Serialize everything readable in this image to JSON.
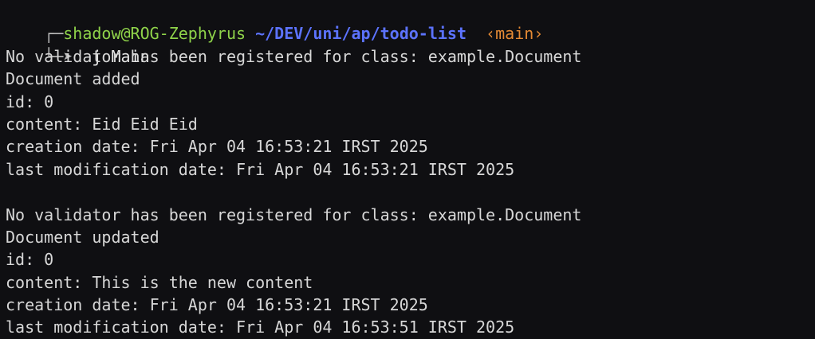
{
  "prompt": {
    "corner_top": "┌─",
    "userhost": "shadow@ROG-Zephyrus",
    "path": "~/DEV/uni/ap/todo-list",
    "branch": "‹main›",
    "corner_bottom": "└─➤",
    "command": "j Main"
  },
  "output": {
    "block1": {
      "line1": "No validator has been registered for class: example.Document",
      "line2": "Document added",
      "line3": "id: 0",
      "line4": "content: Eid Eid Eid",
      "line5": "creation date: Fri Apr 04 16:53:21 IRST 2025",
      "line6": "last modification date: Fri Apr 04 16:53:21 IRST 2025"
    },
    "block2": {
      "line1": "No validator has been registered for class: example.Document",
      "line2": "Document updated",
      "line3": "id: 0",
      "line4": "content: This is the new content",
      "line5": "creation date: Fri Apr 04 16:53:21 IRST 2025",
      "line6": "last modification date: Fri Apr 04 16:53:51 IRST 2025"
    }
  },
  "colors": {
    "background": "#0f0f12",
    "userhost": "#8fd34a",
    "path": "#5c73ff",
    "branch": "#e48a34",
    "text": "#d7d7d7"
  }
}
